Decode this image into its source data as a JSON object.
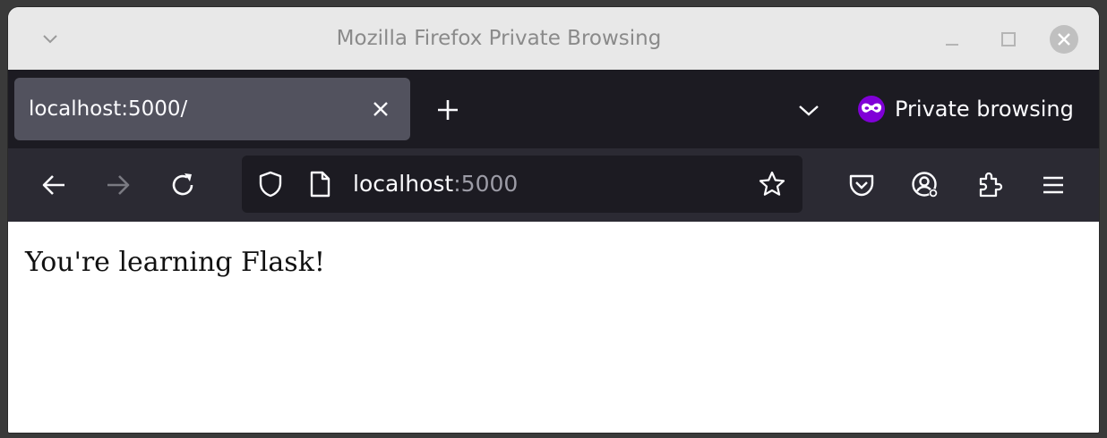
{
  "window": {
    "title": "Mozilla Firefox Private Browsing"
  },
  "tabs": [
    {
      "title": "localhost:5000/",
      "active": true
    }
  ],
  "tabstrip": {
    "private_label": "Private browsing",
    "private_color": "#8000d7"
  },
  "navbar": {
    "url_host": "localhost",
    "url_port": ":5000"
  },
  "page": {
    "message": "You're learning Flask!"
  },
  "icons": {
    "window_menu": "chevron-down-icon",
    "minimize": "minimize-icon",
    "maximize": "maximize-icon",
    "close": "close-icon",
    "tab_close": "close-icon",
    "new_tab": "plus-icon",
    "list_tabs": "chevron-down-icon",
    "private": "private-mask-icon",
    "back": "arrow-left-icon",
    "forward": "arrow-right-icon",
    "reload": "reload-icon",
    "tracking_protection": "shield-icon",
    "page_info": "page-icon",
    "bookmark": "star-icon",
    "pocket": "pocket-icon",
    "account": "account-icon",
    "extensions": "puzzle-icon",
    "app_menu": "hamburger-menu-icon"
  }
}
